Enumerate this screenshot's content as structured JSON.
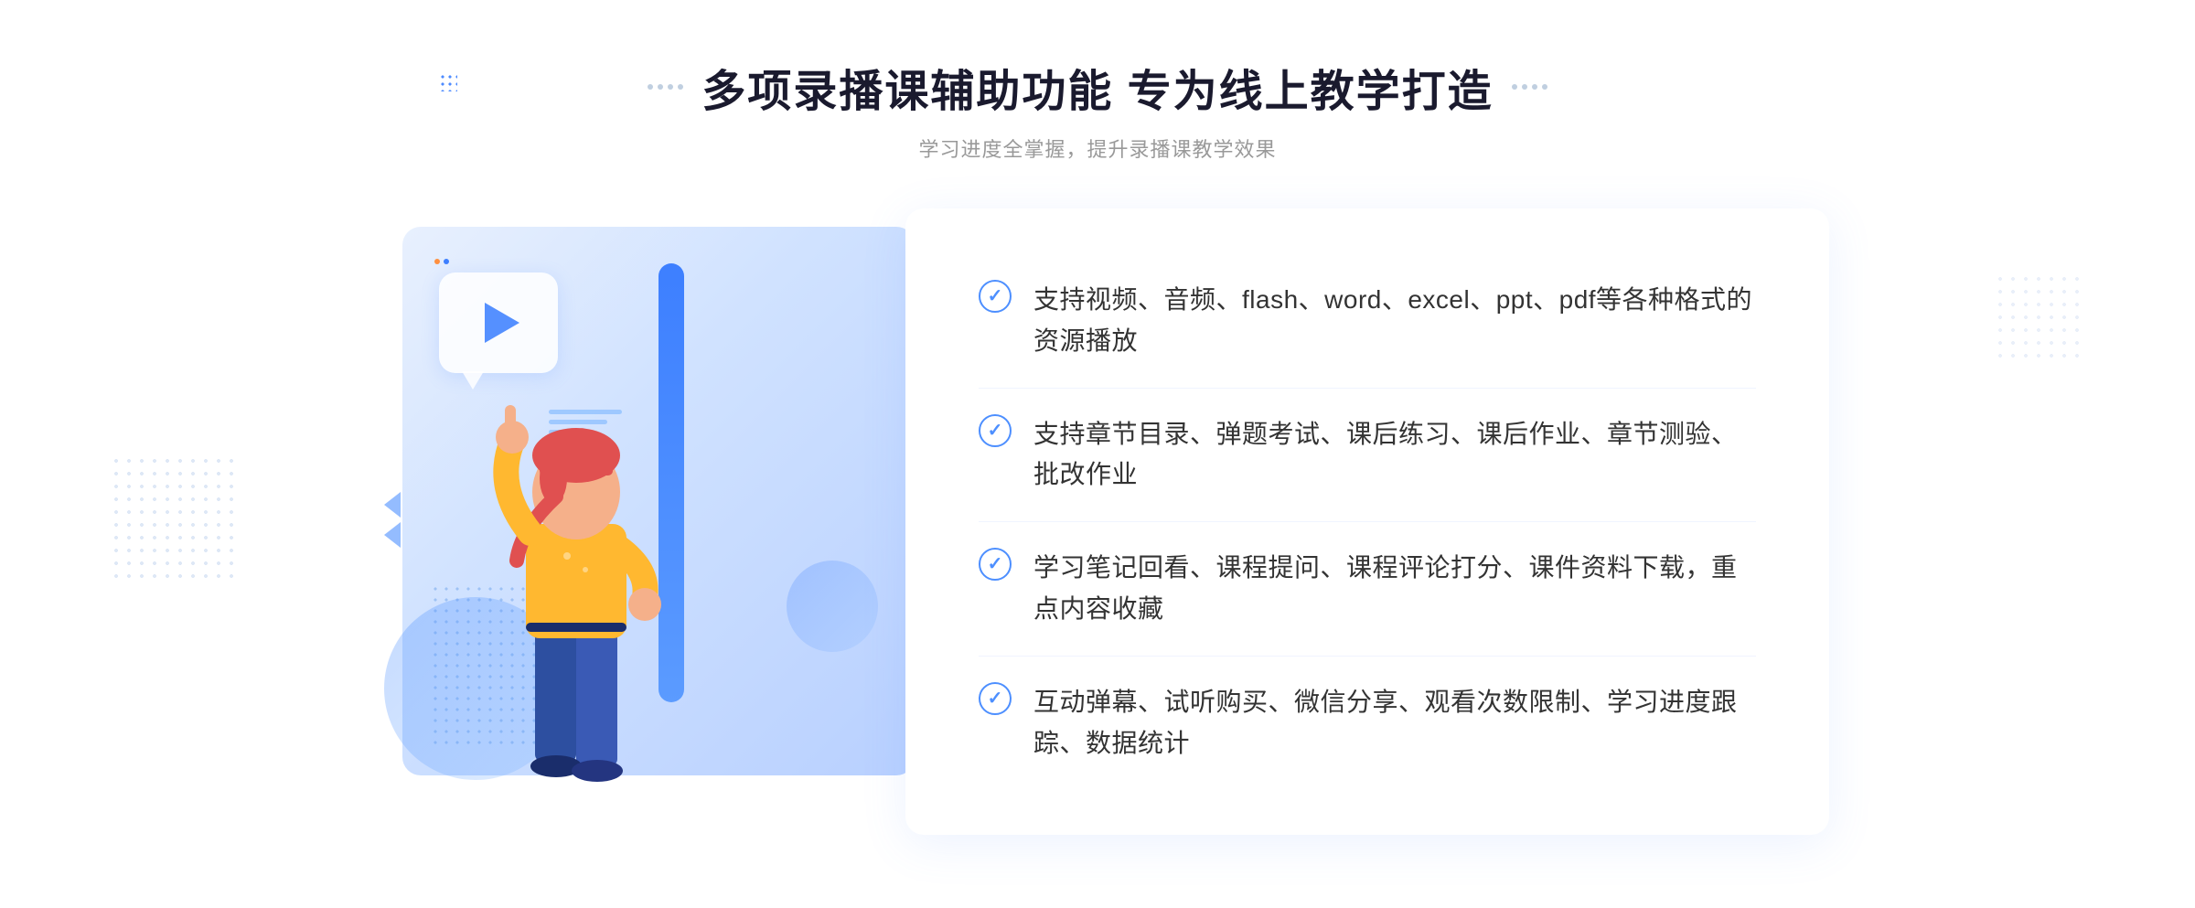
{
  "header": {
    "title": "多项录播课辅助功能 专为线上教学打造",
    "subtitle": "学习进度全掌握，提升录播课教学效果"
  },
  "features": [
    {
      "id": 1,
      "text": "支持视频、音频、flash、word、excel、ppt、pdf等各种格式的资源播放"
    },
    {
      "id": 2,
      "text": "支持章节目录、弹题考试、课后练习、课后作业、章节测验、批改作业"
    },
    {
      "id": 3,
      "text": "学习笔记回看、课程提问、课程评论打分、课件资料下载，重点内容收藏"
    },
    {
      "id": 4,
      "text": "互动弹幕、试听购买、微信分享、观看次数限制、学习进度跟踪、数据统计"
    }
  ],
  "colors": {
    "primary": "#4d8fff",
    "title": "#1a1a2e",
    "text": "#333333",
    "subtitle": "#999999"
  }
}
